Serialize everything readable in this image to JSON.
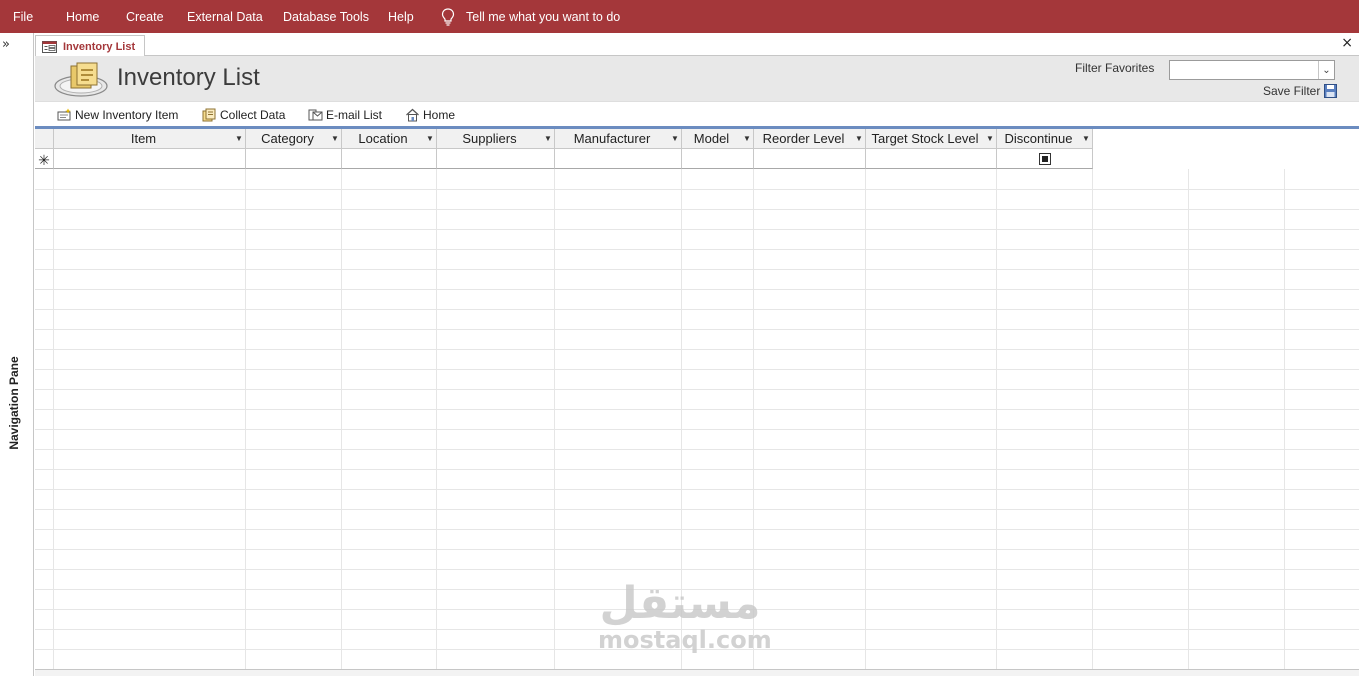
{
  "ribbon": {
    "menu": [
      "File",
      "Home",
      "Create",
      "External Data",
      "Database Tools",
      "Help"
    ],
    "tell_me": "Tell me what you want to do",
    "accent": "#a4373a"
  },
  "nav_pane": {
    "label": "Navigation Pane",
    "expand_glyph": "»"
  },
  "document_tab": {
    "label": "Inventory List",
    "close_glyph": "×"
  },
  "form_header": {
    "title": "Inventory List",
    "filter_favorites_label": "Filter Favorites",
    "filter_favorites_value": "",
    "save_filter_label": "Save Filter"
  },
  "commands": [
    {
      "label": "New Inventory Item",
      "icon": "new-record-icon"
    },
    {
      "label": "Collect Data",
      "icon": "collect-data-icon"
    },
    {
      "label": "E-mail List",
      "icon": "email-icon"
    },
    {
      "label": "Home",
      "icon": "home-icon"
    }
  ],
  "datasheet": {
    "columns": [
      "Item",
      "Category",
      "Location",
      "Suppliers",
      "Manufacturer",
      "Model",
      "Reorder Level",
      "Target Stock Level",
      "Discontinue"
    ],
    "new_record_marker": "✳",
    "discontinue_checkbox": "indeterminate",
    "rows": []
  },
  "watermark": {
    "arabic": "مستقل",
    "latin": "mostaql.com"
  }
}
